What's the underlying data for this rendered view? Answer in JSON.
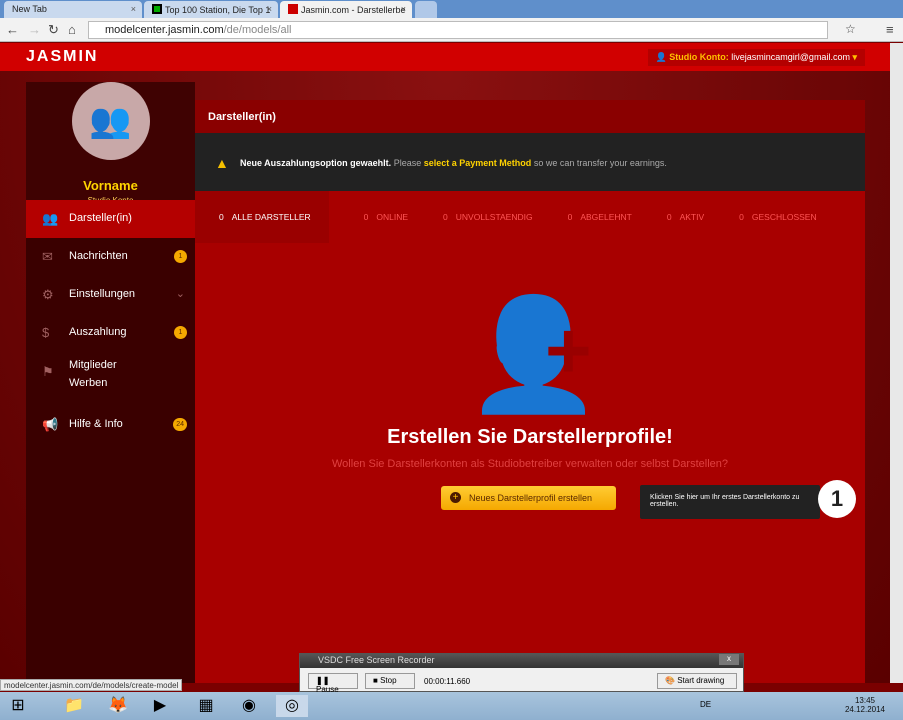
{
  "browser": {
    "tabs": [
      "New Tab",
      "Top 100 Station, Die Top 1",
      "Jasmin.com - Darstellerbe"
    ],
    "url_host": "modelcenter.jasmin.com",
    "url_path": "/de/models/all"
  },
  "header": {
    "logo": "JASMIN",
    "account_label": "Studio Konto:",
    "account_email": "livejasmincamgirl@gmail.com"
  },
  "profile": {
    "name": "Vorname",
    "role": "Studio Konto"
  },
  "sidebar": {
    "items": [
      {
        "label": "Darsteller(in)",
        "icon": "people-icon"
      },
      {
        "label": "Nachrichten",
        "badge": "1",
        "icon": "mail-icon"
      },
      {
        "label": "Einstellungen",
        "icon": "gear-icon"
      },
      {
        "label": "Auszahlung",
        "badge": "1",
        "icon": "money-icon"
      },
      {
        "label": "Mitglieder Werben",
        "icon": "flag-icon"
      },
      {
        "label": "Hilfe & Info",
        "badge": "24",
        "icon": "megaphone-icon"
      }
    ]
  },
  "main": {
    "title": "Darsteller(in)",
    "alert": {
      "bold": "Neue Auszahlungsoption gewaehlt.",
      "pre": "Please",
      "link": "select a Payment Method",
      "post": "so we can transfer your earnings."
    },
    "tabs": [
      {
        "count": "0",
        "label": "ALLE DARSTELLER"
      },
      {
        "count": "0",
        "label": "ONLINE"
      },
      {
        "count": "0",
        "label": "UNVOLLSTAENDIG"
      },
      {
        "count": "0",
        "label": "ABGELEHNT"
      },
      {
        "count": "0",
        "label": "AKTIV"
      },
      {
        "count": "0",
        "label": "GESCHLOSSEN"
      }
    ],
    "empty_title": "Erstellen Sie Darstellerprofile!",
    "empty_sub": "Wollen Sie Darstellerkonten als Studiobetreiber verwalten oder selbst Darstellen?",
    "create_button": "Neues Darstellerprofil erstellen",
    "tooltip": "Klicken Sie hier um Ihr erstes Darstellerkonto zu erstellen.",
    "step": "1"
  },
  "status_url": "modelcenter.jasmin.com/de/models/create-model",
  "recorder": {
    "title": "VSDC Free Screen Recorder",
    "pause": "Pause",
    "stop": "Stop",
    "time": "00:00:11.660",
    "draw": "Start drawing"
  },
  "taskbar": {
    "lang": "DE",
    "time": "13:45",
    "date": "24.12.2014"
  }
}
